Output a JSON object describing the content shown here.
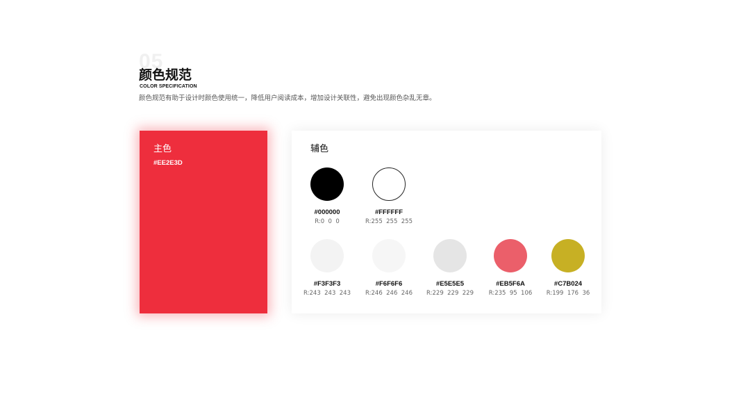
{
  "header": {
    "number": "05",
    "title": "颜色规范",
    "subtitle": "COLOR SPECIFICATION",
    "description": "颜色规范有助于设计时颜色使用统一，降低用户阅读成本，增加设计关联性，避免出现颜色杂乱无章。"
  },
  "primary": {
    "label": "主色",
    "hex": "#EE2E3D",
    "color": "#EE2E3D"
  },
  "secondary": {
    "label": "辅色",
    "swatches": [
      {
        "hex": "#000000",
        "rgb": "R:0  0  0",
        "color": "#000000",
        "outlined": false
      },
      {
        "hex": "#FFFFFF",
        "rgb": "R:255  255  255",
        "color": "#FFFFFF",
        "outlined": true
      },
      {
        "hex": "#F3F3F3",
        "rgb": "R:243  243  243",
        "color": "#F3F3F3",
        "outlined": false
      },
      {
        "hex": "#F6F6F6",
        "rgb": "R:246  246  246",
        "color": "#F6F6F6",
        "outlined": false
      },
      {
        "hex": "#E5E5E5",
        "rgb": "R:229  229  229",
        "color": "#E5E5E5",
        "outlined": false
      },
      {
        "hex": "#EB5F6A",
        "rgb": "R:235  95  106",
        "color": "#EB5F6A",
        "outlined": false
      },
      {
        "hex": "#C7B024",
        "rgb": "R:199  176  36",
        "color": "#C7B024",
        "outlined": false
      }
    ]
  }
}
